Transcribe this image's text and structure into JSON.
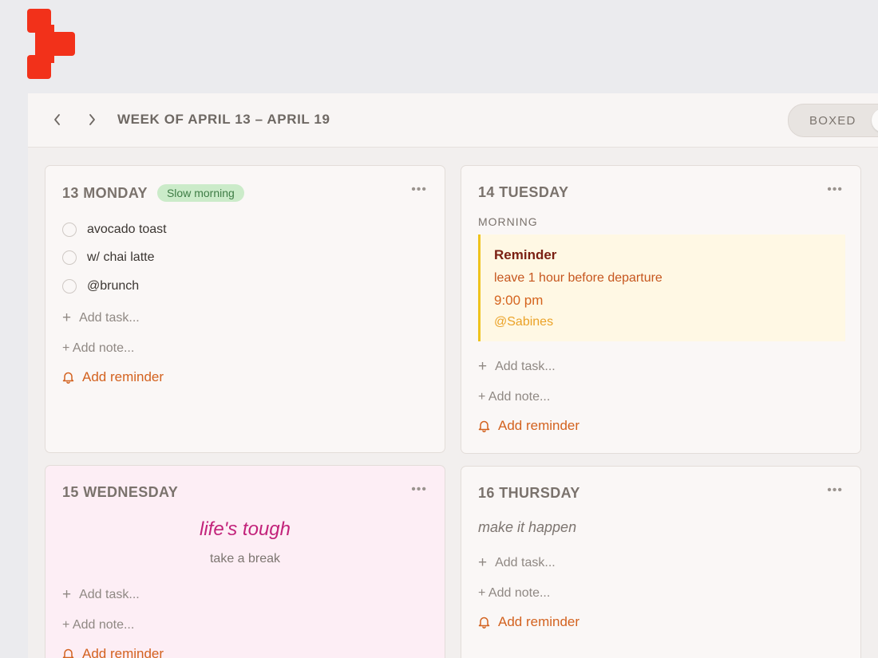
{
  "brand": {
    "logo_icon": "brand-logo-icon",
    "logo_color": "#f2311a"
  },
  "toolbar": {
    "prev_icon": "chevron-left-icon",
    "next_icon": "chevron-right-icon",
    "week_title": "WEEK OF APRIL 13 – APRIL 19",
    "view_toggle_label": "BOXED"
  },
  "actions": {
    "add_task": "Add task...",
    "add_note": "+ Add note...",
    "add_reminder": "Add reminder",
    "more": "•••"
  },
  "days": {
    "monday": {
      "title": "13 MONDAY",
      "badge": "Slow morning",
      "tasks": [
        {
          "label": "avocado toast",
          "done": false
        },
        {
          "label": "w/ chai latte",
          "done": false
        },
        {
          "label": "@brunch",
          "done": false
        }
      ]
    },
    "tuesday": {
      "title": "14 TUESDAY",
      "section": "MORNING",
      "reminder": {
        "title": "Reminder",
        "text": "leave 1 hour before departure",
        "time": "9:00 pm",
        "user": "@Sabines"
      }
    },
    "wednesday": {
      "title": "15 WEDNESDAY",
      "quote": "life's tough",
      "quote_sub": "take a break"
    },
    "thursday": {
      "title": "16 THURSDAY",
      "note": "make it happen"
    }
  },
  "colors": {
    "accent_orange": "#d3621f",
    "badge_green": "#cbebc9",
    "reminder_bg": "#fff8e4",
    "reminder_bar": "#efc31d",
    "quote_pink": "#c2227a",
    "wednesday_bg": "#fdeef5"
  }
}
